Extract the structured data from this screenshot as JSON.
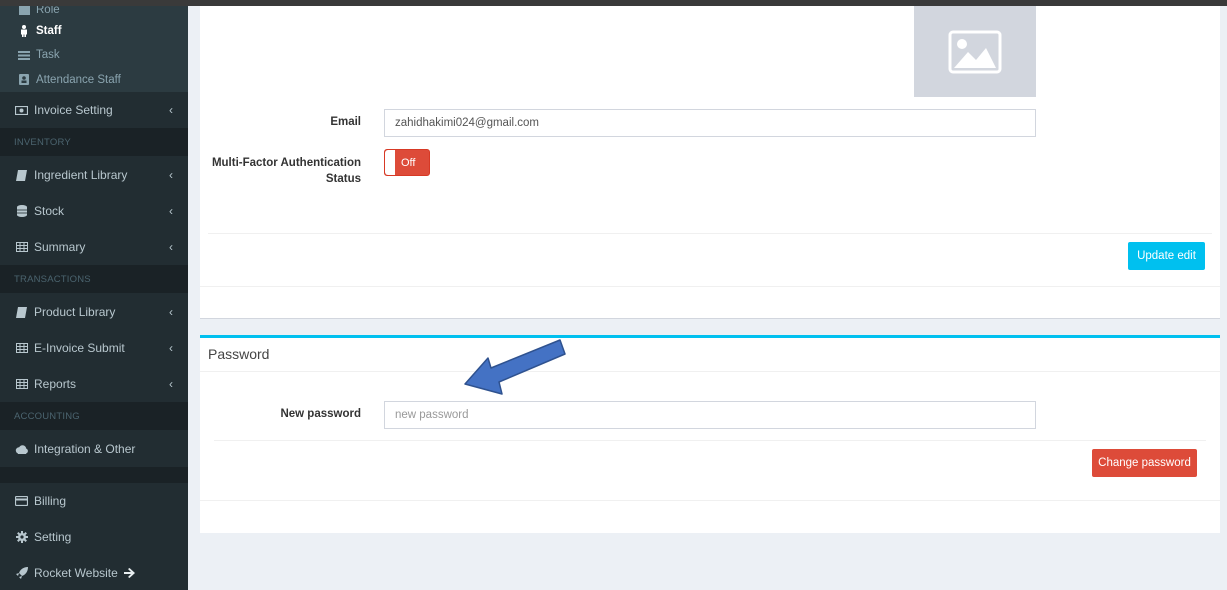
{
  "sidebar": {
    "items": [
      {
        "label": "Role",
        "icon": "user-tag-icon"
      },
      {
        "label": "Staff",
        "icon": "person-icon"
      },
      {
        "label": "Task",
        "icon": "list-icon"
      },
      {
        "label": "Attendance Staff",
        "icon": "id-card-icon"
      },
      {
        "label": "Invoice Setting",
        "icon": "money-icon"
      },
      {
        "header": "INVENTORY"
      },
      {
        "label": "Ingredient Library",
        "icon": "book-icon"
      },
      {
        "label": "Stock",
        "icon": "database-icon"
      },
      {
        "label": "Summary",
        "icon": "table-icon"
      },
      {
        "header": "TRANSACTIONS"
      },
      {
        "label": "Product Library",
        "icon": "book-icon"
      },
      {
        "label": "E-Invoice Submit",
        "icon": "table-icon"
      },
      {
        "label": "Reports",
        "icon": "table-icon"
      },
      {
        "header": "ACCOUNTING"
      },
      {
        "label": "Integration & Other",
        "icon": "cloud-icon"
      },
      {
        "label": "Billing",
        "icon": "credit-card-icon"
      },
      {
        "label": "Setting",
        "icon": "gear-icon"
      },
      {
        "label": "Rocket Website",
        "icon": "rocket-icon"
      }
    ],
    "role": "Role",
    "staff": "Staff",
    "task": "Task",
    "attendance": "Attendance Staff",
    "invoice_setting": "Invoice Setting",
    "inventory_header": "INVENTORY",
    "ingredient_library": "Ingredient Library",
    "stock": "Stock",
    "summary": "Summary",
    "transactions_header": "TRANSACTIONS",
    "product_library": "Product Library",
    "einvoice_submit": "E-Invoice Submit",
    "reports": "Reports",
    "accounting_header": "ACCOUNTING",
    "integration": "Integration & Other",
    "billing": "Billing",
    "setting": "Setting",
    "rocket_website": "Rocket Website"
  },
  "profile": {
    "email_label": "Email",
    "email_value": "zahidhakimi024@gmail.com",
    "mfa_label_line1": "Multi-Factor Authentication",
    "mfa_label_line2": "Status",
    "mfa_toggle_text": "Off",
    "update_button": "Update edit"
  },
  "password": {
    "title": "Password",
    "new_password_label": "New password",
    "new_password_placeholder": "new password",
    "change_button": "Change password"
  },
  "colors": {
    "sidebar_bg": "#222d32",
    "accent_blue": "#00c0ef",
    "danger_red": "#dd4b39",
    "annotation_arrow": "#4472c4"
  }
}
